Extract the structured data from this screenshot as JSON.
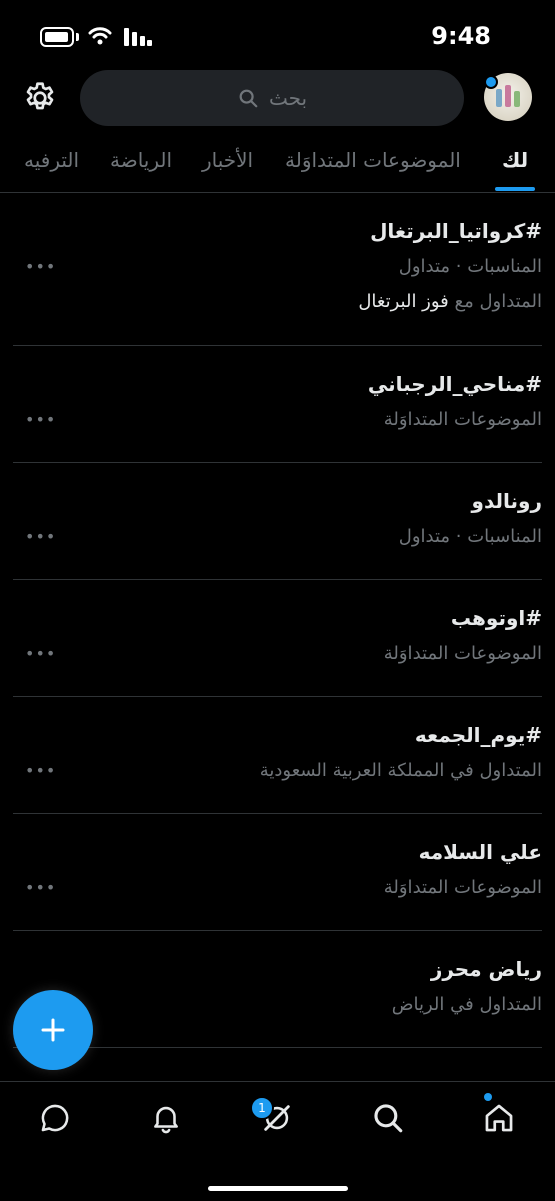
{
  "status_bar": {
    "time": "9:48"
  },
  "search": {
    "placeholder": "بحث"
  },
  "tabs": [
    {
      "label": "لك",
      "active": true
    },
    {
      "label": "الموضوعات المتداوَلة",
      "active": false
    },
    {
      "label": "الأخبار",
      "active": false
    },
    {
      "label": "الرياضة",
      "active": false
    },
    {
      "label": "الترفيه",
      "active": false
    }
  ],
  "trends": [
    {
      "title": "#كرواتيا_البرتغال",
      "meta": "المناسبات · متداول",
      "extra_prefix": "المتداول مع",
      "extra_topic": "فوز البرتغال"
    },
    {
      "title": "#مناحي_الرجباني",
      "meta": "الموضوعات المتداوَلة"
    },
    {
      "title": "رونالدو",
      "meta": "المناسبات · متداول"
    },
    {
      "title": "#اوتوهب",
      "meta": "الموضوعات المتداوَلة"
    },
    {
      "title": "#يوم_الجمعه",
      "meta": "المتداول في المملكة العربية السعودية"
    },
    {
      "title": "علي السلامه",
      "meta": "الموضوعات المتداوَلة"
    },
    {
      "title": "رياض محرز",
      "meta": "المتداول في الرياض"
    }
  ],
  "more_glyph": "•••",
  "bottom_nav": {
    "notifications_badge": "1"
  },
  "colors": {
    "accent": "#1d9bf0",
    "background": "#000000",
    "secondary_text": "#71767b"
  },
  "icons": [
    "gear-icon",
    "search-icon",
    "plus-icon",
    "messages-icon",
    "bell-icon",
    "spaces-icon",
    "home-icon"
  ]
}
